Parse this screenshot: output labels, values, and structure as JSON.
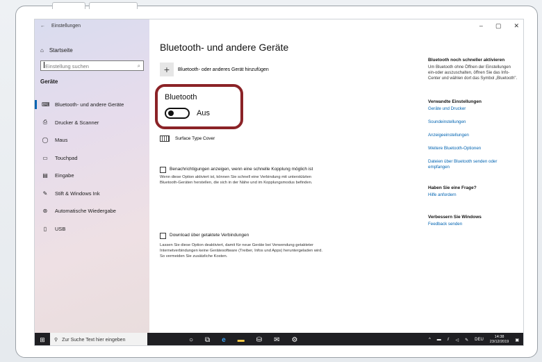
{
  "window": {
    "title": "Einstellungen",
    "back_icon": "←",
    "controls": [
      "–",
      "▢",
      "✕"
    ]
  },
  "sidebar": {
    "home": "Startseite",
    "search_placeholder": "Einstellung suchen",
    "section": "Geräte",
    "items": [
      {
        "icon": "bluetooth-devices-icon",
        "glyph": "⌨",
        "label": "Bluetooth- und andere Geräte",
        "active": true
      },
      {
        "icon": "printer-icon",
        "glyph": "⎙",
        "label": "Drucker & Scanner"
      },
      {
        "icon": "mouse-icon",
        "glyph": "◯",
        "label": "Maus"
      },
      {
        "icon": "touchpad-icon",
        "glyph": "▭",
        "label": "Touchpad"
      },
      {
        "icon": "keyboard-icon",
        "glyph": "▤",
        "label": "Eingabe"
      },
      {
        "icon": "pen-icon",
        "glyph": "✎",
        "label": "Stift & Windows Ink"
      },
      {
        "icon": "autoplay-icon",
        "glyph": "⊛",
        "label": "Automatische Wiedergabe"
      },
      {
        "icon": "usb-icon",
        "glyph": "▯",
        "label": "USB"
      }
    ]
  },
  "main": {
    "title": "Bluetooth- und andere Geräte",
    "add_device": "Bluetooth- oder anderes Gerät hinzufügen",
    "bluetooth_label": "Bluetooth",
    "toggle_state": "Aus",
    "device": "Surface Type Cover",
    "swift_pair": {
      "label": "Benachrichtigungen anzeigen, wenn eine schnelle Kopplung möglich ist",
      "desc": "Wenn diese Option aktiviert ist, können Sie schnell eine Verbindung mit unterstützten Bluetooth-Geräten herstellen, die sich in der Nähe und im Kopplungsmodus befinden."
    },
    "metered": {
      "label": "Download über getaktete Verbindungen",
      "desc": "Lassen Sie diese Option deaktiviert, damit für neue Geräte bei Verwendung getakteter Internetverbindungen keine Gerätesoftware (Treiber, Infos und Apps) heruntergeladen wird. So vermeiden Sie zusätzliche Kosten."
    }
  },
  "right": {
    "faster_head": "Bluetooth noch schneller aktivieren",
    "faster_text": "Um Bluetooth ohne Öffnen der Einstellungen ein-oder auszuschalten, öffnen Sie das Info-Center und wählen dort das Symbol „Bluetooth\".",
    "related_head": "Verwandte Einstellungen",
    "related_links": [
      "Geräte und Drucker",
      "Soundeinstellungen",
      "Anzeigeeinstellungen",
      "Weitere Bluetooth-Optionen",
      "Dateien über Bluetooth senden oder empfangen"
    ],
    "question_head": "Haben Sie eine Frage?",
    "help_link": "Hilfe anfordern",
    "improve_head": "Verbessern Sie Windows",
    "feedback_link": "Feedback senden"
  },
  "taskbar": {
    "search": "Zur Suche Text hier eingeben",
    "lang": "DEU",
    "time": "14:38",
    "date": "23/12/2019"
  }
}
